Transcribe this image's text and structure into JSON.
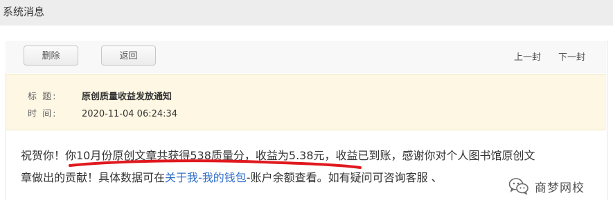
{
  "header": {
    "title": "系统消息"
  },
  "toolbar": {
    "delete_label": "删除",
    "back_label": "返回",
    "prev_label": "上一封",
    "next_label": "下一封"
  },
  "message": {
    "subject_label": "标 题:",
    "subject": "原创质量收益发放通知",
    "time_label": "时 间:",
    "time": "2020-11-04 06:24:34",
    "body_line1": "祝贺你！你10月份原创文章共获得538质量分，收益为5.38元，收益已到账，感谢你对个人图书馆原创文",
    "body_line2_before": "章做出的贡献！具体数据可在",
    "body_line2_link": "关于我-我的钱包",
    "body_line2_after": "-账户余额查看。如有疑问可咨询客服 、"
  },
  "watermark": {
    "text": "商梦网校",
    "icon": "wechat-icon"
  },
  "colors": {
    "header_bg": "#ededed",
    "meta_bg": "#fdf7e3",
    "link": "#2f6ec8",
    "annotation": "#e0191f"
  }
}
